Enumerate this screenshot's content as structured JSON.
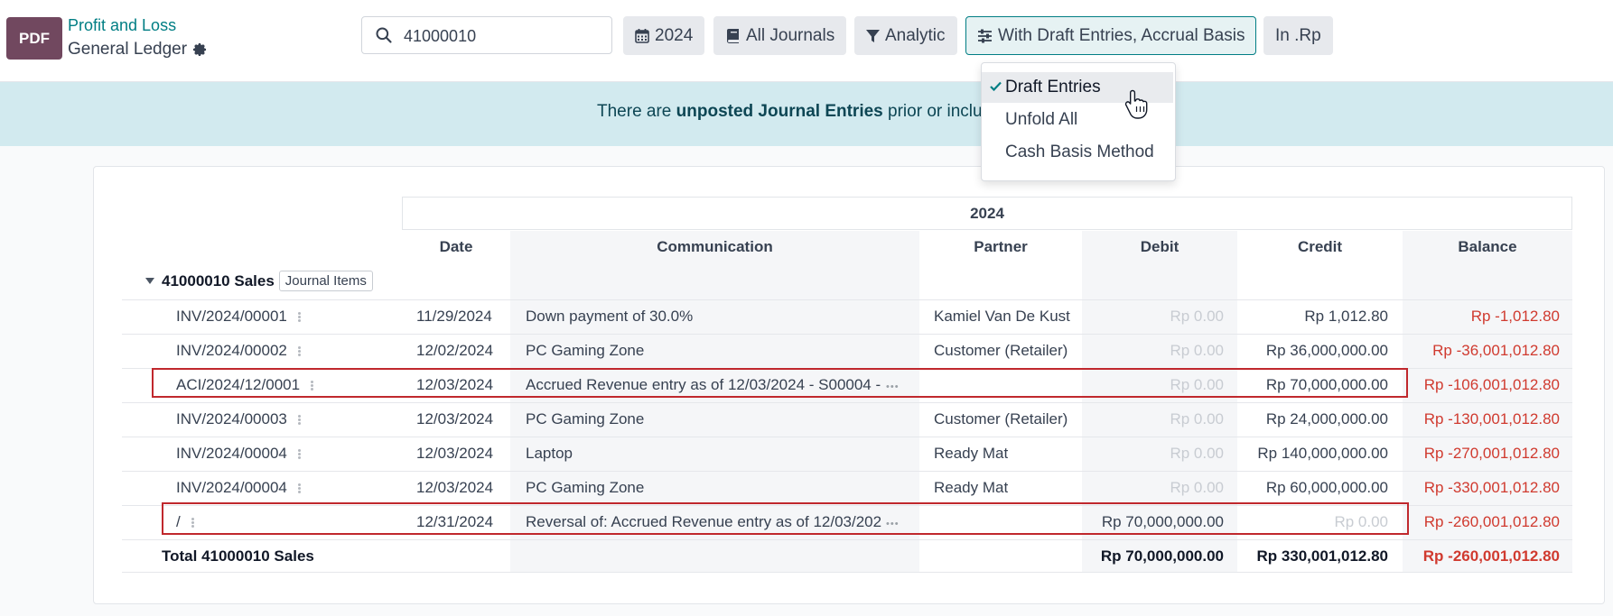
{
  "header": {
    "pdf_label": "PDF",
    "breadcrumb_parent": "Profit and Loss",
    "breadcrumb_current": "General Ledger",
    "search_value": "41000010",
    "filters": {
      "period": "2024",
      "journals": "All Journals",
      "analytic": "Analytic",
      "options": "With Draft Entries, Accrual Basis",
      "currency": "In .Rp"
    }
  },
  "dropdown": {
    "items": [
      {
        "label": "Draft Entries",
        "checked": true
      },
      {
        "label": "Unfold All",
        "checked": false
      },
      {
        "label": "Cash Basis Method",
        "checked": false
      }
    ]
  },
  "banner": {
    "prefix": "There are ",
    "bold": "unposted Journal Entries",
    "suffix": " prior or include"
  },
  "table": {
    "period_header": "2024",
    "columns": [
      "Date",
      "Communication",
      "Partner",
      "Debit",
      "Credit",
      "Balance"
    ],
    "group": {
      "title": "41000010 Sales",
      "badge": "Journal Items"
    },
    "rows": [
      {
        "ref": "INV/2024/00001",
        "date": "11/29/2024",
        "communication": "Down payment of 30.0%",
        "partner": "Kamiel Van De Kust",
        "debit": "Rp 0.00",
        "credit": "Rp 1,012.80",
        "balance": "Rp -1,012.80"
      },
      {
        "ref": "INV/2024/00002",
        "date": "12/02/2024",
        "communication": "PC Gaming Zone",
        "partner": "Customer (Retailer)",
        "debit": "Rp 0.00",
        "credit": "Rp 36,000,000.00",
        "balance": "Rp -36,001,012.80"
      },
      {
        "ref": "ACI/2024/12/0001",
        "date": "12/03/2024",
        "communication": "Accrued Revenue entry as of 12/03/2024 - S00004 -",
        "partner": "",
        "debit": "Rp 0.00",
        "credit": "Rp 70,000,000.00",
        "balance": "Rp -106,001,012.80"
      },
      {
        "ref": "INV/2024/00003",
        "date": "12/03/2024",
        "communication": "PC Gaming Zone",
        "partner": "Customer (Retailer)",
        "debit": "Rp 0.00",
        "credit": "Rp 24,000,000.00",
        "balance": "Rp -130,001,012.80"
      },
      {
        "ref": "INV/2024/00004",
        "date": "12/03/2024",
        "communication": "Laptop",
        "partner": "Ready Mat",
        "debit": "Rp 0.00",
        "credit": "Rp 140,000,000.00",
        "balance": "Rp -270,001,012.80"
      },
      {
        "ref": "INV/2024/00004",
        "date": "12/03/2024",
        "communication": "PC Gaming Zone",
        "partner": "Ready Mat",
        "debit": "Rp 0.00",
        "credit": "Rp 60,000,000.00",
        "balance": "Rp -330,001,012.80"
      },
      {
        "ref": "/",
        "date": "12/31/2024",
        "communication": "Reversal of: Accrued Revenue entry as of 12/03/202",
        "partner": "",
        "debit": "Rp 70,000,000.00",
        "credit": "Rp 0.00",
        "balance": "Rp -260,001,012.80"
      }
    ],
    "total": {
      "label": "Total 41000010 Sales",
      "debit": "Rp 70,000,000.00",
      "credit": "Rp 330,001,012.80",
      "balance": "Rp -260,001,012.80"
    }
  },
  "colors": {
    "brand": "#71485f",
    "accent": "#017e84",
    "negative": "#d03a2f",
    "highlight_box": "#c0282d"
  }
}
